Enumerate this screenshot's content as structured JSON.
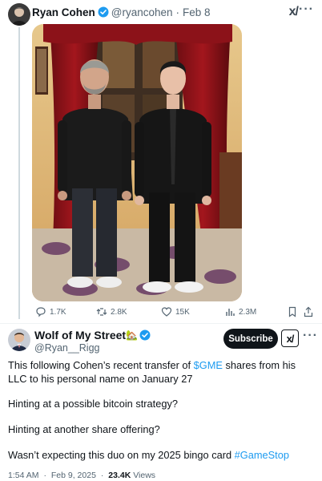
{
  "quoted": {
    "name": "Ryan Cohen",
    "handle": "@ryancohen",
    "separator": "·",
    "date": "Feb 8",
    "grok_label": "x/",
    "more": "···",
    "actions": {
      "replies": "1.7K",
      "reposts": "2.8K",
      "likes": "15K",
      "views": "2.3M"
    }
  },
  "post": {
    "name": "Wolf of My Street",
    "name_emoji": "🏡",
    "handle": "@Ryan__Rigg",
    "subscribe_label": "Subscribe",
    "grok_label": "x/",
    "more": "···",
    "line1_a": "This following Cohen’s recent transfer of ",
    "line1_ticker": "$GME",
    "line1_b": " shares from his LLC to his personal name on January 27",
    "line2": "Hinting at a possible bitcoin strategy?",
    "line3": "Hinting at another share offering?",
    "line4_a": "Wasn’t expecting this duo on my 2025 bingo card ",
    "line4_tag": "#GameStop",
    "time": "1:54 AM",
    "separator": "·",
    "date": "Feb 9, 2025",
    "views": "23.4K",
    "views_label": "Views"
  },
  "colors": {
    "link": "#1d9bf0",
    "verified": "#1d9bf0",
    "muted": "#536471",
    "text": "#0f1419"
  }
}
